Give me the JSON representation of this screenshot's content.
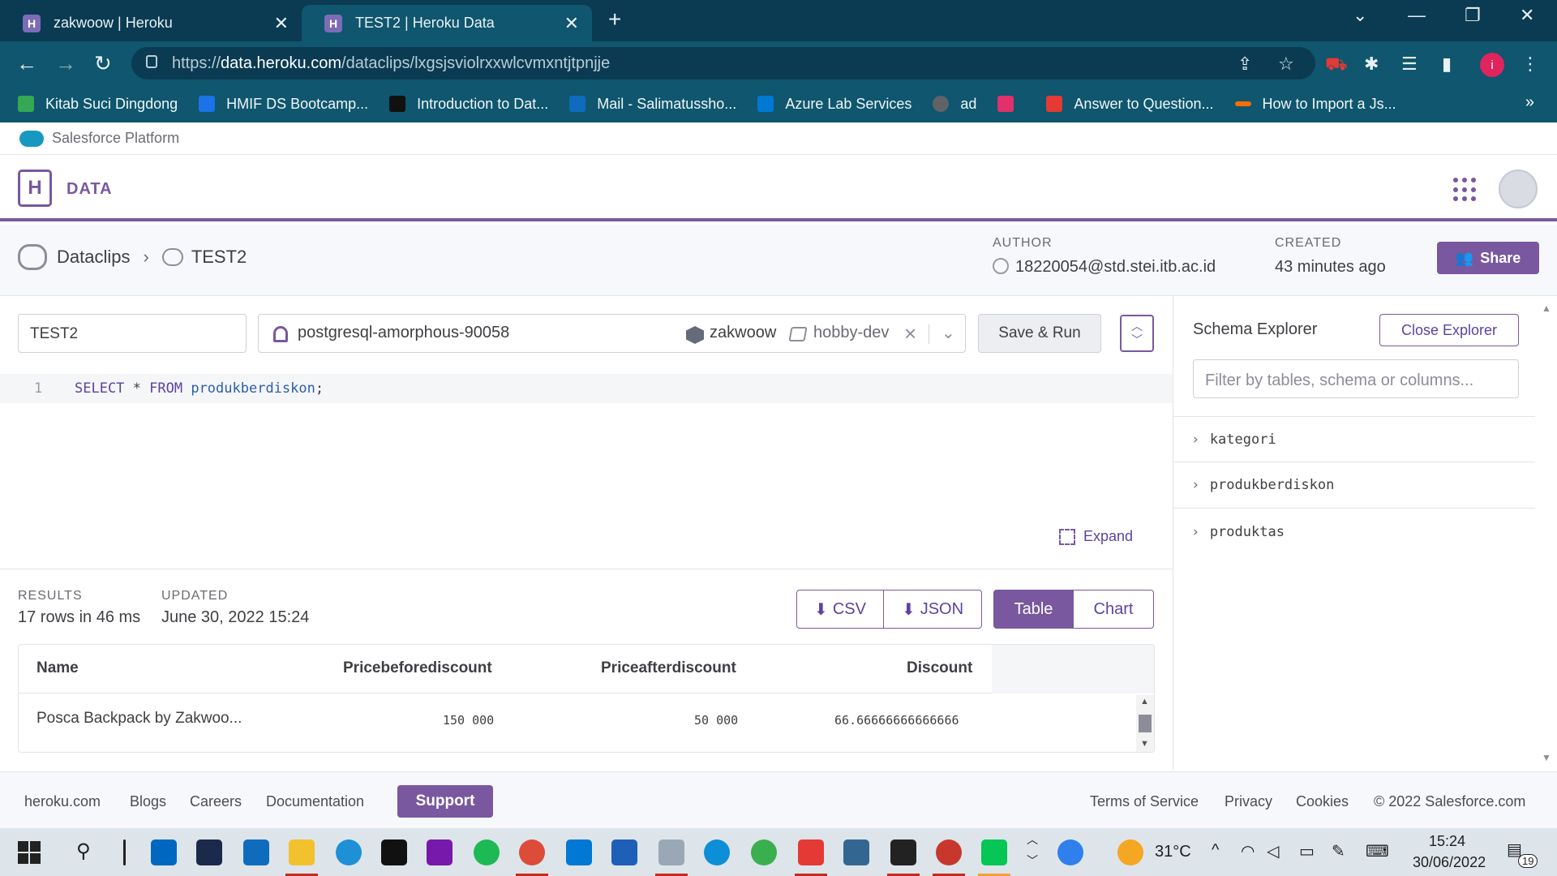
{
  "browser": {
    "tabs": [
      {
        "title": "zakwoow | Heroku",
        "active": false
      },
      {
        "title": "TEST2 | Heroku Data",
        "active": true
      }
    ],
    "url_prefix": "https://",
    "url_host": "data.heroku.com",
    "url_path": "/dataclips/lxgsjsviolrxxwlcvmxntjtpnjje",
    "profile_initial": "i",
    "bookmarks": [
      {
        "label": "Kitab Suci Dingdong",
        "color": "#34a853"
      },
      {
        "label": "HMIF DS Bootcamp...",
        "color": "#1a73e8"
      },
      {
        "label": "Introduction to Dat...",
        "color": "#111111"
      },
      {
        "label": "Mail - Salimatussho...",
        "color": "#0f6cbd"
      },
      {
        "label": "Azure Lab Services",
        "color": "#0078d4"
      },
      {
        "label": "ad",
        "color": "#5f6368"
      },
      {
        "label": "",
        "color": "#e1306c"
      },
      {
        "label": "Answer to Question...",
        "color": "#e53935"
      },
      {
        "label": "How to Import a Js...",
        "color": "#ff6d00"
      }
    ]
  },
  "platform": {
    "label": "Salesforce Platform"
  },
  "header": {
    "logo_letter": "H",
    "title": "DATA"
  },
  "subheader": {
    "breadcrumb_root": "Dataclips",
    "breadcrumb_current": "TEST2",
    "author_label": "AUTHOR",
    "author_value": "18220054@std.stei.itb.ac.id",
    "created_label": "CREATED",
    "created_value": "43 minutes ago",
    "share_label": "Share"
  },
  "editor": {
    "clip_name": "TEST2",
    "database": "postgresql-amorphous-90058",
    "app": "zakwoow",
    "plan": "hobby-dev",
    "save_run_label": "Save & Run",
    "line_number": "1",
    "sql_keyword1": "SELECT",
    "sql_symbol": " * ",
    "sql_keyword2": "FROM",
    "sql_table": " produkberdiskon",
    "sql_end": ";",
    "expand_label": "Expand"
  },
  "results": {
    "results_label": "RESULTS",
    "results_value": "17 rows in 46 ms",
    "updated_label": "UPDATED",
    "updated_value": "June 30, 2022 15:24",
    "csv_label": "CSV",
    "json_label": "JSON",
    "table_label": "Table",
    "chart_label": "Chart",
    "columns": [
      "Name",
      "Pricebeforediscount",
      "Priceafterdiscount",
      "Discount"
    ],
    "rows": [
      [
        "Posca Backpack by Zakwoo...",
        "150 000",
        "50 000",
        "66.66666666666666"
      ]
    ]
  },
  "schema": {
    "title": "Schema Explorer",
    "close_label": "Close Explorer",
    "filter_placeholder": "Filter by tables, schema or columns...",
    "tables": [
      "kategori",
      "produkberdiskon",
      "produktas"
    ]
  },
  "footer": {
    "links_left": [
      "heroku.com",
      "Blogs",
      "Careers",
      "Documentation"
    ],
    "support_label": "Support",
    "links_right": [
      "Terms of Service",
      "Privacy",
      "Cookies",
      "© 2022 Salesforce.com"
    ]
  },
  "taskbar": {
    "weather": "31°C",
    "time": "15:24",
    "date": "30/06/2022",
    "notification_count": "19"
  },
  "colors": {
    "accent": "#79589f",
    "chrome": "#0f566e",
    "chrome_dark": "#0a3b52"
  }
}
